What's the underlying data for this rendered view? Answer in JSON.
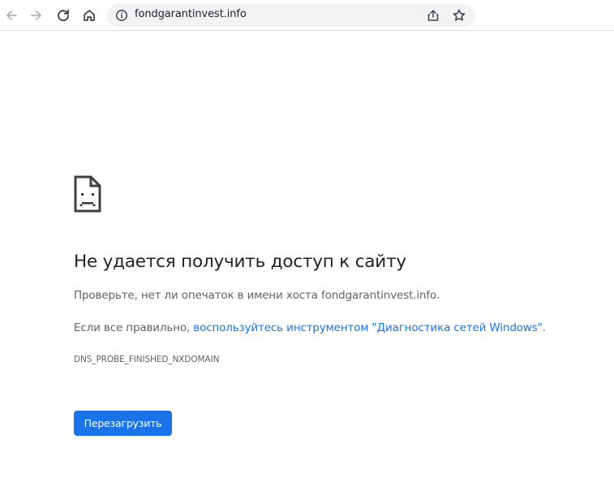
{
  "toolbar": {
    "back_icon": "arrow-back-icon",
    "forward_icon": "arrow-forward-icon",
    "reload_icon": "reload-icon",
    "home_icon": "home-icon"
  },
  "omnibox": {
    "url": "fondgarantinvest.info",
    "info_icon": "info-icon",
    "share_icon": "share-icon",
    "star_icon": "bookmark-star-icon"
  },
  "error_page": {
    "icon": "sad-page-icon",
    "heading": "Не удается получить доступ к сайту",
    "check_text": "Проверьте, нет ли опечаток в имени хоста fondgarantinvest.info.",
    "fix_prefix": "Если все правильно, ",
    "fix_link": "воспользуйтесь инструментом \"Диагностика сетей Windows\"",
    "fix_suffix": ".",
    "error_code": "DNS_PROBE_FINISHED_NXDOMAIN",
    "reload_label": "Перезагрузить"
  },
  "colors": {
    "accent": "#1a73e8",
    "text_primary": "#202124",
    "text_secondary": "#5f6368",
    "omnibox_bg": "#f1f3f4"
  }
}
